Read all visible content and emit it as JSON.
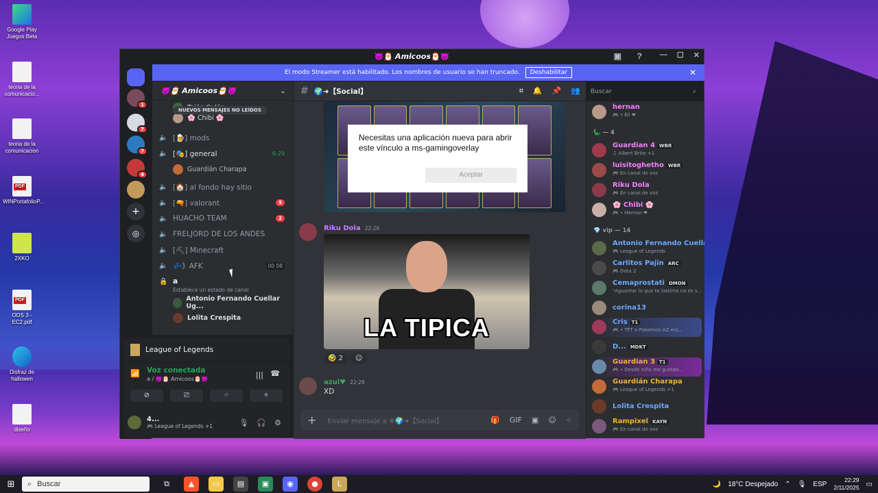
{
  "desktop": {
    "icons": [
      {
        "label": "Google Play\nJuegos Beta"
      },
      {
        "label": "teoria de la\ncomunicacio..."
      },
      {
        "label": "teoria de la\ncomunicacion"
      },
      {
        "label": "WINPortafolioP..."
      },
      {
        "label": "2XKO"
      },
      {
        "label": "ODS 3 - EC2.pdf"
      },
      {
        "label": "Disfraz de\nhallowen"
      },
      {
        "label": "diseño"
      }
    ]
  },
  "window": {
    "title": "👿🎅 𝘼𝙢𝙞𝙘𝙤𝙤𝙨🎅👿"
  },
  "banner": {
    "text": "El modo Streamer está habilitado. Los nombres de usuario se han truncado.",
    "button": "Deshabilitar"
  },
  "servers": [
    {
      "badge": "1",
      "color": "#7a4a5a"
    },
    {
      "badge": "7",
      "color": "#d9d9e6"
    },
    {
      "badge": "7",
      "color": "#2f7abf"
    },
    {
      "badge": "4",
      "color": "#c23a3a"
    },
    {
      "badge": "",
      "color": "#c29a5a"
    }
  ],
  "server_header": {
    "name": "👿🎅 Amicoos🎅👿"
  },
  "channels": {
    "new_messages_pill": "NUEVOS MENSAJES NO LEÍDOS",
    "top_members": [
      {
        "name": "Tejón Culón"
      },
      {
        "name": "🌸 Chibi 🌸"
      }
    ],
    "items": [
      {
        "name": "[🍺] mods",
        "count": "",
        "extra": ""
      },
      {
        "name": "[🎭] general",
        "count": "",
        "extra": "6:29"
      },
      {
        "name": "[🏠] al fondo hay sitio",
        "count": "",
        "extra": ""
      },
      {
        "name": "[🔫] valorant",
        "count": "5",
        "extra": ""
      },
      {
        "name": "HUACHO TEAM",
        "count": "2",
        "extra": ""
      },
      {
        "name": "FRELJORD DE LOS ANDES",
        "count": "",
        "extra": ""
      },
      {
        "name": "[⛏] Minecraft",
        "count": "",
        "extra": ""
      },
      {
        "name": "💤》AFK",
        "count": "",
        "extra": "00  08"
      }
    ],
    "general_member": "Guardián Charapa",
    "locked_channel": {
      "name": "a",
      "status": "Establece un estado de canal"
    },
    "locked_members": [
      {
        "name": "Antonio Fernando Cuellar Ug..."
      },
      {
        "name": "Lolita Crespita"
      }
    ]
  },
  "voice_panel": {
    "game": "League of Legends",
    "status": "Voz conectada",
    "location": "a / 👿🎅 Amicoos🎅👿",
    "user_name": "4...",
    "user_status": "🎮 League of Legends +1"
  },
  "chat": {
    "channel": "🌍➜【Social】",
    "messages": [
      {
        "author": "Riku Dola",
        "time": "22:26",
        "author_color": "#c77dff",
        "image_caption": "LA TIPICA"
      },
      {
        "author": "azul♥",
        "time": "22:28",
        "author_color": "#3ba55d",
        "text": "XD"
      }
    ],
    "reactions": [
      {
        "emoji": "🤣",
        "count": "2"
      }
    ],
    "composer_placeholder": "Enviar mensaje a #🌍➜【Social】"
  },
  "dialog": {
    "text": "Necesitas una aplicación nueva para abrir este vínculo a ms-gamingoverlay",
    "button": "Aceptar"
  },
  "search": {
    "placeholder": "Buscar"
  },
  "members": {
    "top": [
      {
        "name": "hernan",
        "status": "🎮 • Eli ❤",
        "color": "#f47fff"
      }
    ],
    "group1": "🦕 — 4",
    "group1_members": [
      {
        "name": "Guardian 4",
        "tag": "WBR",
        "status": "♫ Albert Brite +1",
        "color": "#f47fff"
      },
      {
        "name": "luisitoghetho",
        "tag": "WBR",
        "status": "🎮 En canal de voz",
        "color": "#f47fff"
      },
      {
        "name": "Riku Dola",
        "tag": "",
        "status": "🎮 En canal de voz",
        "color": "#f47fff"
      },
      {
        "name": "🌸 Chibi 🌸",
        "tag": "",
        "status": "🎮 • Hernan ❤",
        "color": "#f47fff"
      }
    ],
    "group2": "💎 vip — 14",
    "group2_members": [
      {
        "name": "Antonio Fernando Cuella...",
        "tag": "",
        "status": "🎮 League of Legends",
        "color": "#6aa9ff"
      },
      {
        "name": "Carlitos Pajin",
        "tag": "ARC",
        "status": "🎮 Dota 2",
        "color": "#6aa9ff"
      },
      {
        "name": "Cemaprostati",
        "tag": "DMON",
        "status": "\"Aguantar lo que te lastima no es s...",
        "color": "#6aa9ff"
      },
      {
        "name": "corina13",
        "tag": "",
        "status": "",
        "color": "#6aa9ff"
      },
      {
        "name": "Cris",
        "tag": "T1",
        "status": "🎮 • TFT n Pokemon AZ enj...",
        "color": "#6aa9ff"
      },
      {
        "name": "D...",
        "tag": "MDKT",
        "status": "",
        "color": "#6aa9ff"
      },
      {
        "name": "Guardian 3",
        "tag": "T1",
        "status": "🎮 • Desde niño me gustab...",
        "color": "#f0b232"
      },
      {
        "name": "Guardián Charapa",
        "tag": "",
        "status": "🎮 League of Legends +1",
        "color": "#f0b232"
      },
      {
        "name": "Lolita Crespita",
        "tag": "",
        "status": "",
        "color": "#6aa9ff"
      },
      {
        "name": "Rampixel",
        "tag": "KAYN",
        "status": "🎮 En canal de voz",
        "color": "#f0b232"
      }
    ]
  },
  "taskbar": {
    "search": "Buscar",
    "weather": "18°C  Despejado",
    "lang": "ESP",
    "time": "22:29",
    "date": "2/11/2025"
  }
}
